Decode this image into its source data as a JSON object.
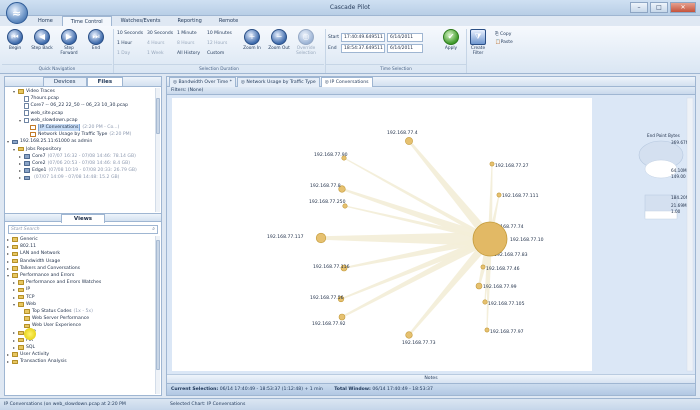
{
  "window": {
    "title": "Cascade Pilot",
    "controls": {
      "minimize": "–",
      "maximize": "□",
      "close": "✕"
    },
    "orb_glyph": "≈"
  },
  "menu": [
    "Home",
    "Time Control",
    "Watches/Events",
    "Reporting",
    "Remote"
  ],
  "menu_active": 1,
  "ribbon": {
    "nav_buttons": [
      {
        "label": "Begin",
        "icon": "begin-icon",
        "glyph": "⏮"
      },
      {
        "label": "Step Back",
        "icon": "step-back-icon",
        "glyph": "◀"
      },
      {
        "label": "Step Forward",
        "icon": "step-forward-icon",
        "glyph": "▶"
      },
      {
        "label": "End",
        "icon": "end-icon",
        "glyph": "⏭"
      }
    ],
    "quick_nav_label": "Quick Navigation",
    "durations": [
      {
        "label": "10 Seconds",
        "enabled": true
      },
      {
        "label": "30 Seconds",
        "enabled": true
      },
      {
        "label": "1 Minute",
        "enabled": true
      },
      {
        "label": "10 Minutes",
        "enabled": true
      },
      {
        "label": "1 Hour",
        "enabled": true
      },
      {
        "label": "4 Hours",
        "enabled": false
      },
      {
        "label": "8 Hours",
        "enabled": false
      },
      {
        "label": "12 Hours",
        "enabled": false
      },
      {
        "label": "1 Day",
        "enabled": false
      },
      {
        "label": "1 Week",
        "enabled": false
      },
      {
        "label": "All History",
        "enabled": true
      },
      {
        "label": "Custom",
        "enabled": true
      }
    ],
    "zoom_buttons": [
      {
        "label": "Zoom In",
        "icon": "zoom-in-icon",
        "glyph": "+"
      },
      {
        "label": "Zoom Out",
        "icon": "zoom-out-icon",
        "glyph": "−"
      },
      {
        "label": "Override Selection",
        "icon": "override-selection-icon",
        "glyph": "◎"
      }
    ],
    "selection_duration_label": "Selection Duration",
    "start_label": "Start",
    "end_label": "End",
    "start_time": "17:40:49.649511",
    "start_date": "6/14/2011",
    "end_time": "18:54:37.649511",
    "end_date": "6/14/2011",
    "apply_label": "Apply",
    "time_selection_label": "Time Selection",
    "create_filter_label": "Create Filter",
    "copy_label": "Copy",
    "paste_label": "Paste"
  },
  "left_pane": {
    "tabs": [
      "Devices",
      "Files"
    ],
    "active_tab": 1,
    "files_tree": [
      {
        "indent": 1,
        "exp": "▾",
        "icon": "folder",
        "label": "Video Traces"
      },
      {
        "indent": 2,
        "exp": "",
        "icon": "doc",
        "label": "7hours.pcap"
      },
      {
        "indent": 2,
        "exp": "",
        "icon": "doc",
        "label": "Core7 -- 06_22 22_50 -- 06_23 10_30.pcap"
      },
      {
        "indent": 2,
        "exp": "",
        "icon": "doc",
        "label": "web_site.pcap"
      },
      {
        "indent": 2,
        "exp": "▾",
        "icon": "doc",
        "label": "web_slowdown.pcap"
      },
      {
        "indent": 3,
        "exp": "",
        "icon": "chart",
        "label": "IP Conversations",
        "extra": "(2:20 PM - Co...)",
        "selected": true
      },
      {
        "indent": 3,
        "exp": "",
        "icon": "chart",
        "label": "Network Usage by Traffic Type",
        "extra": "(2:20 PM)"
      },
      {
        "indent": 0,
        "exp": "▾",
        "icon": "srv",
        "label": "192.168.25.11:61000 as admin"
      },
      {
        "indent": 1,
        "exp": "▾",
        "icon": "folder",
        "label": "Jobs Repository"
      },
      {
        "indent": 2,
        "exp": "▸",
        "icon": "srv",
        "label": "Core7",
        "extra": "(07/07 16:32 - 07/08 14:46: 78.14 GB)"
      },
      {
        "indent": 2,
        "exp": "▸",
        "icon": "srv",
        "label": "Core2",
        "extra": "(07/06 20:53 - 07/08 14:46: 8.4 GB)"
      },
      {
        "indent": 2,
        "exp": "▸",
        "icon": "srv",
        "label": "Edge1",
        "extra": "(07/08 10:19 - 07/08 20:33: 26.79 GB)"
      },
      {
        "indent": 2,
        "exp": "▸",
        "icon": "srv",
        "label": "",
        "extra": "(07/07 14:09 - 07/08 14:48: 15.2 GB)"
      }
    ],
    "views_label": "Views",
    "search_placeholder": "Start Search",
    "views_tree": [
      {
        "indent": 0,
        "exp": "▸",
        "label": "Generic"
      },
      {
        "indent": 0,
        "exp": "▸",
        "label": "802.11"
      },
      {
        "indent": 0,
        "exp": "▸",
        "label": "LAN and Network"
      },
      {
        "indent": 0,
        "exp": "▸",
        "label": "Bandwidth Usage"
      },
      {
        "indent": 0,
        "exp": "▸",
        "label": "Talkers and Conversations"
      },
      {
        "indent": 0,
        "exp": "▾",
        "label": "Performance and Errors"
      },
      {
        "indent": 1,
        "exp": "▸",
        "label": "Performance and Errors Watches"
      },
      {
        "indent": 1,
        "exp": "▸",
        "label": "IP"
      },
      {
        "indent": 1,
        "exp": "▸",
        "label": "TCP"
      },
      {
        "indent": 1,
        "exp": "▾",
        "label": "Web"
      },
      {
        "indent": 2,
        "exp": "",
        "label": "Top Status Codes",
        "extra": "(1x - 5x)"
      },
      {
        "indent": 2,
        "exp": "",
        "label": "Web Server Performance"
      },
      {
        "indent": 2,
        "exp": "",
        "label": "Web User Experience"
      },
      {
        "indent": 1,
        "exp": "▸",
        "label": "VoIP"
      },
      {
        "indent": 1,
        "exp": "▸",
        "label": "FIX"
      },
      {
        "indent": 1,
        "exp": "▸",
        "label": "SQL"
      },
      {
        "indent": 0,
        "exp": "▸",
        "label": "User Activity"
      },
      {
        "indent": 0,
        "exp": "▸",
        "label": "Transaction Analysis"
      }
    ]
  },
  "main": {
    "doc_tabs": [
      {
        "label": "Bandwidth Over Time *",
        "active": false
      },
      {
        "label": "Network Usage by Traffic Type",
        "active": false
      },
      {
        "label": "IP Conversations",
        "active": true
      }
    ],
    "filters_text": "Filters: (None)",
    "notes_label": "Notes",
    "current_selection_label": "Current Selection:",
    "current_selection_value": "06/14 17:40:49 - 18:53:37 (1:12:48) + 1 min",
    "total_window_label": "Total Window:",
    "total_window_value": "06/14 17:40:49 - 18:53:37"
  },
  "chart_data": {
    "type": "network-graph",
    "center": {
      "label": "192.168.77.10"
    },
    "nodes": [
      {
        "label": "192.168.77.4",
        "weight": 0.35
      },
      {
        "label": "192.168.77.27",
        "weight": 0.1
      },
      {
        "label": "192.168.77.111",
        "weight": 0.1
      },
      {
        "label": "192.168.77.74",
        "weight": 0.1
      },
      {
        "label": "192.168.77.83",
        "weight": 0.1
      },
      {
        "label": "192.168.77.46",
        "weight": 0.1
      },
      {
        "label": "192.168.77.99",
        "weight": 0.25
      },
      {
        "label": "192.168.77.105",
        "weight": 0.12
      },
      {
        "label": "192.168.77.97",
        "weight": 0.1
      },
      {
        "label": "192.168.77.73",
        "weight": 0.3
      },
      {
        "label": "192.168.77.92",
        "weight": 0.25
      },
      {
        "label": "192.168.77.56",
        "weight": 0.22
      },
      {
        "label": "192.168.77.116",
        "weight": 0.25
      },
      {
        "label": "192.168.77.117",
        "weight": 0.55
      },
      {
        "label": "192.168.77.250",
        "weight": 0.12
      },
      {
        "label": "192.168.77.8",
        "weight": 0.3
      },
      {
        "label": "192.168.77.90",
        "weight": 0.12
      }
    ],
    "legend": {
      "title": "End Point Bytes",
      "entries": [
        "369.67M",
        "64.10M",
        "149.00",
        "184.20M",
        "21.69M",
        "1.00"
      ]
    }
  },
  "statusbar": {
    "left": "IP Conversations (on web_slowdown.pcap at 2:20 PM",
    "right": "Selected Chart: IP Conversations"
  },
  "colors": {
    "node_fill": "#e6c170",
    "node_stroke": "#c39a3a",
    "center_fill": "#e2b965",
    "edge": "#f3eed9",
    "plot_bg": "#dbe7f6"
  }
}
